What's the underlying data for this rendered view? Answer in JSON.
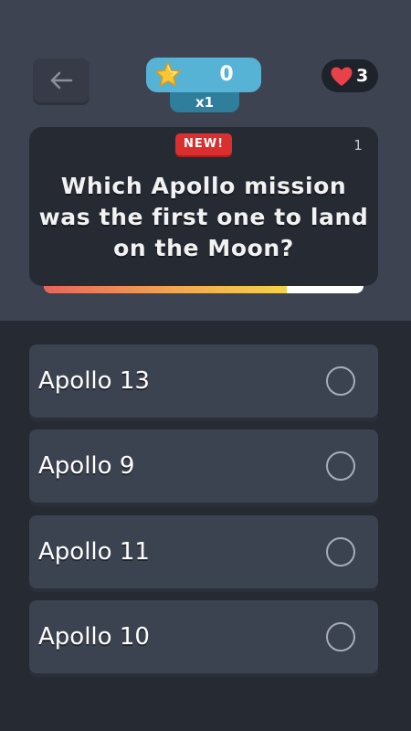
{
  "header": {
    "back_icon": "arrow-left-icon",
    "score": {
      "icon": "star-icon",
      "value": "0",
      "multiplier": "x1"
    },
    "lives": {
      "icon": "heart-icon",
      "value": "3"
    }
  },
  "question": {
    "badge": "NEW!",
    "number": "1",
    "text": "Which Apollo mission was the first one to land on the Moon?",
    "timer_remaining": 0.76
  },
  "answers": [
    {
      "label": "Apollo 13"
    },
    {
      "label": "Apollo 9"
    },
    {
      "label": "Apollo 11"
    },
    {
      "label": "Apollo 10"
    }
  ],
  "colors": {
    "top_panel": "#3d4350",
    "background": "#262b33",
    "score_pill": "#57b3d6",
    "badge": "#d92f2f",
    "heart": "#e8414a"
  }
}
